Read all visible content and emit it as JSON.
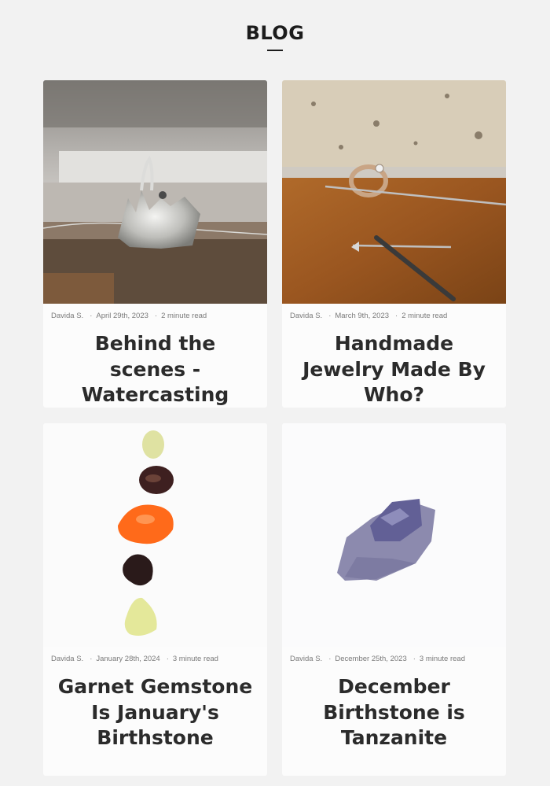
{
  "header": {
    "title": "BLOG"
  },
  "posts": [
    {
      "author": "Davida S.",
      "date": "April 29th, 2023",
      "read": "2 minute read",
      "title": "Behind the scenes - Watercasting"
    },
    {
      "author": "Davida S.",
      "date": "March 9th, 2023",
      "read": "2 minute read",
      "title": "Handmade Jewelry Made By Who?"
    },
    {
      "author": "Davida S.",
      "date": "January 28th, 2024",
      "read": "3 minute read",
      "title": "Garnet Gemstone Is January's Birthstone"
    },
    {
      "author": "Davida S.",
      "date": "December 25th, 2023",
      "read": "3 minute read",
      "title": "December Birthstone is Tanzanite"
    }
  ]
}
